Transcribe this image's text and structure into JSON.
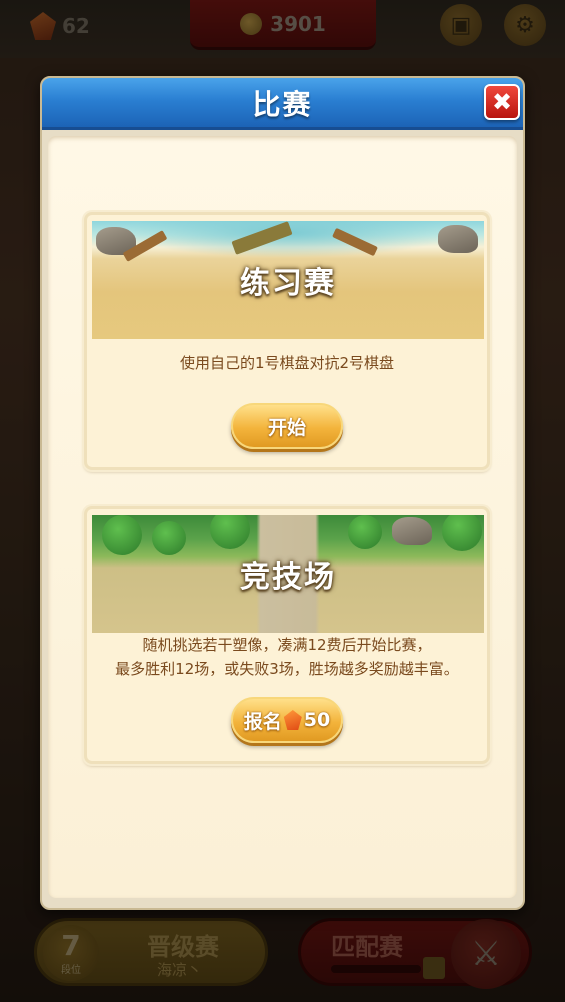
{
  "topbar": {
    "gem_count": "62",
    "coin_count": "3901"
  },
  "modal": {
    "title": "比赛",
    "close_icon": "close-icon"
  },
  "modes": {
    "practice": {
      "title": "练习赛",
      "description": "使用自己的1号棋盘对抗2号棋盘",
      "button_label": "开始"
    },
    "arena": {
      "title": "竞技场",
      "description_line1": "随机挑选若干塑像，凑满12费后开始比赛，",
      "description_line2": "最多胜利12场，或失败3场，胜场越多奖励越丰富。",
      "button_label": "报名",
      "cost": "50",
      "cost_icon": "gem-icon"
    }
  },
  "bottom": {
    "rank_number": "7",
    "rank_label": "段位",
    "ranked_title": "晋级赛",
    "ranked_subtitle": "海凉丶",
    "match_title": "匹配赛"
  },
  "colors": {
    "header_blue": "#2a7fd2",
    "close_red": "#d4271c",
    "button_gold": "#f3b43c",
    "text_brown": "#7a4a1e"
  }
}
